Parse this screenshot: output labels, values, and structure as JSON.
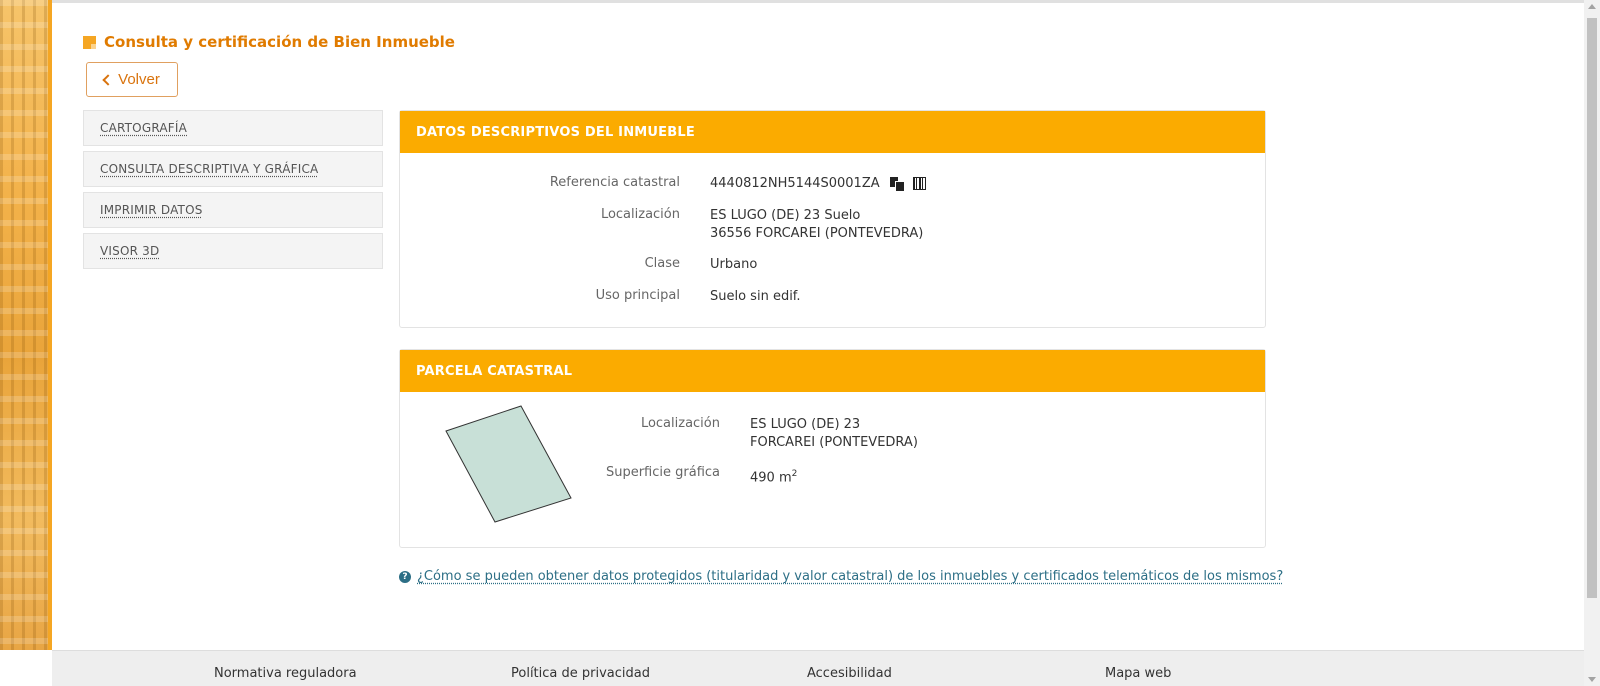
{
  "page": {
    "title": "Consulta y certificación de Bien Inmueble",
    "back_label": "Volver"
  },
  "sidebar": {
    "items": [
      {
        "label": "CARTOGRAFÍA"
      },
      {
        "label": "CONSULTA DESCRIPTIVA Y GRÁFICA"
      },
      {
        "label": "IMPRIMIR DATOS"
      },
      {
        "label": "VISOR 3D"
      }
    ]
  },
  "datos": {
    "header": "DATOS DESCRIPTIVOS DEL INMUEBLE",
    "ref_label": "Referencia catastral",
    "ref_value": "4440812NH5144S0001ZA",
    "loc_label": "Localización",
    "loc_line1": "ES LUGO (DE) 23 Suelo",
    "loc_line2": "36556 FORCAREI (PONTEVEDRA)",
    "clase_label": "Clase",
    "clase_value": "Urbano",
    "uso_label": "Uso principal",
    "uso_value": "Suelo sin edif."
  },
  "parcela": {
    "header": "PARCELA CATASTRAL",
    "loc_label": "Localización",
    "loc_line1": "ES LUGO (DE) 23",
    "loc_line2": "FORCAREI (PONTEVEDRA)",
    "sup_label": "Superficie gráfica",
    "sup_value": "490 m",
    "sup_unit_sup": "2",
    "parcel_fill": "#c8e0d7",
    "parcel_stroke": "#333333"
  },
  "help": {
    "link_text": "¿Cómo se pueden obtener datos protegidos (titularidad y valor catastral) de los inmuebles y certificados telemáticos de los mismos?"
  },
  "footer": {
    "links": [
      {
        "label": "Normativa reguladora"
      },
      {
        "label": "Política de privacidad"
      },
      {
        "label": "Accesibilidad"
      },
      {
        "label": "Mapa web"
      }
    ]
  },
  "icons": [
    "title-square-icon",
    "chevron-left-icon",
    "copy-icon",
    "barcode-icon",
    "question-icon"
  ],
  "colors": {
    "accent": "#fbab00",
    "title": "#e07b00",
    "link": "#2d6f86"
  }
}
